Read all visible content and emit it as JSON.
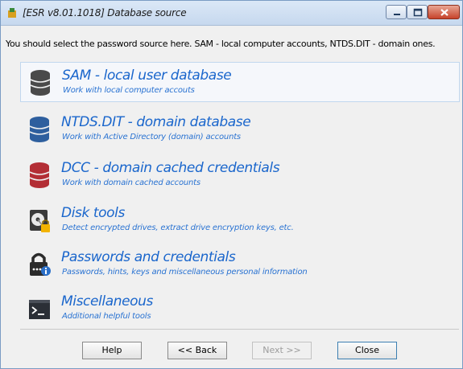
{
  "window": {
    "title": "[ESR v8.01.1018]  Database source"
  },
  "intro_text": "You should select the password source here. SAM - local computer accounts, NTDS.DIT - domain ones.",
  "items": [
    {
      "label": "SAM - local user database",
      "desc": "Work with local computer accouts",
      "icon": "database-gray-icon",
      "color": "#4a4a4a"
    },
    {
      "label": "NTDS.DIT - domain database",
      "desc": "Work with Active Directory (domain) accounts",
      "icon": "database-blue-icon",
      "color": "#2e5f9e"
    },
    {
      "label": "DCC - domain cached credentials",
      "desc": "Work with domain cached accounts",
      "icon": "database-red-icon",
      "color": "#b32e35"
    },
    {
      "label": "Disk tools",
      "desc": "Detect encrypted drives, extract drive encryption keys, etc.",
      "icon": "disk-lock-icon"
    },
    {
      "label": "Passwords and credentials",
      "desc": "Passwords, hints, keys and miscellaneous personal information",
      "icon": "padlock-info-icon"
    },
    {
      "label": "Miscellaneous",
      "desc": "Additional helpful tools",
      "icon": "terminal-icon"
    }
  ],
  "buttons": {
    "help": "Help",
    "back": "<< Back",
    "next": "Next >>",
    "close": "Close"
  }
}
